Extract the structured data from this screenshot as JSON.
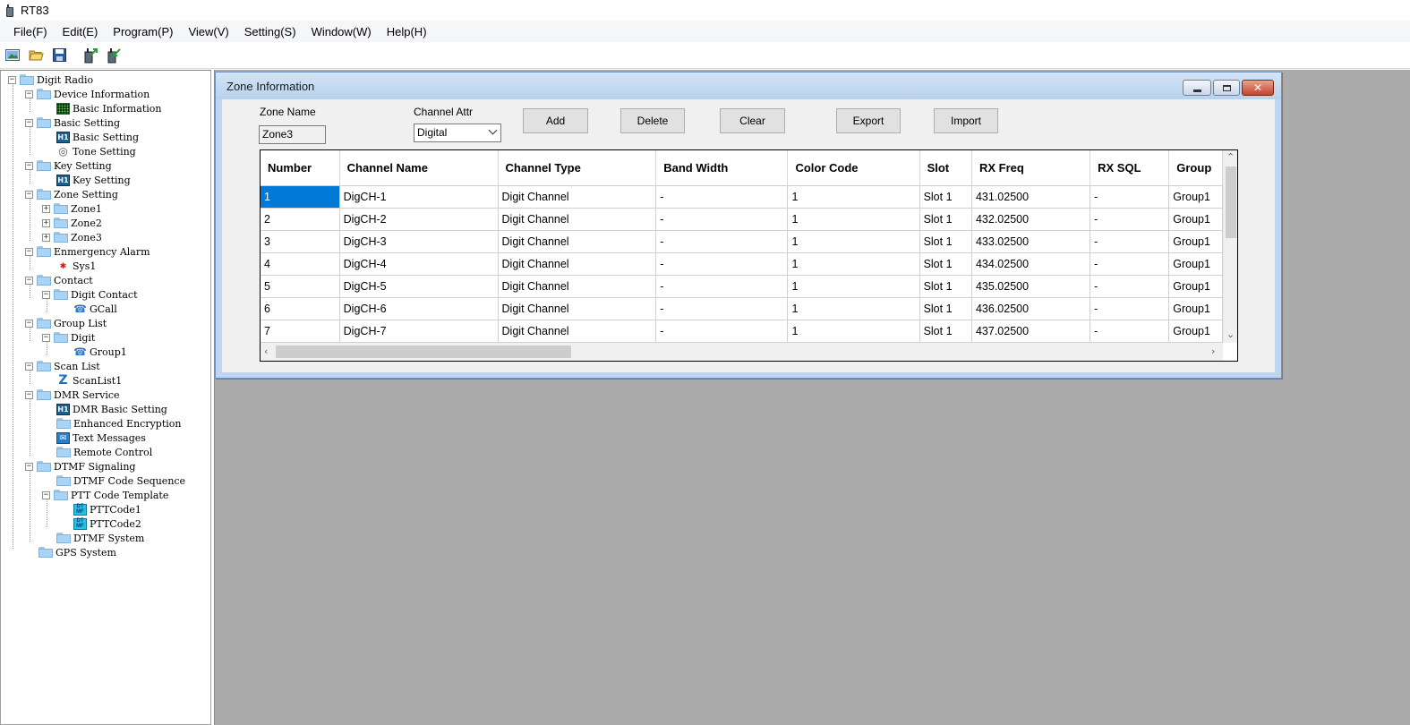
{
  "window": {
    "title": "RT83"
  },
  "menu": [
    "File(F)",
    "Edit(E)",
    "Program(P)",
    "View(V)",
    "Setting(S)",
    "Window(W)",
    "Help(H)"
  ],
  "toolbar": [
    "new-icon",
    "open-icon",
    "save-icon",
    "read-radio-icon",
    "write-radio-icon"
  ],
  "tree": {
    "root": "Digit Radio",
    "nodes": [
      {
        "label": "Device Information"
      },
      {
        "label": "Basic Information"
      },
      {
        "label": "Basic Setting"
      },
      {
        "label": "Basic Setting"
      },
      {
        "label": "Tone Setting"
      },
      {
        "label": "Key Setting"
      },
      {
        "label": "Key Setting"
      },
      {
        "label": "Zone Setting"
      },
      {
        "label": "Zone1"
      },
      {
        "label": "Zone2"
      },
      {
        "label": "Zone3"
      },
      {
        "label": "Enmergency Alarm"
      },
      {
        "label": "Sys1"
      },
      {
        "label": "Contact"
      },
      {
        "label": "Digit Contact"
      },
      {
        "label": "GCall"
      },
      {
        "label": "Group List"
      },
      {
        "label": "Digit"
      },
      {
        "label": "Group1"
      },
      {
        "label": "Scan List"
      },
      {
        "label": "ScanList1"
      },
      {
        "label": "DMR Service"
      },
      {
        "label": "DMR Basic Setting"
      },
      {
        "label": "Enhanced Encryption"
      },
      {
        "label": "Text Messages"
      },
      {
        "label": "Remote Control"
      },
      {
        "label": "DTMF Signaling"
      },
      {
        "label": "DTMF Code Sequence"
      },
      {
        "label": "PTT Code Template"
      },
      {
        "label": "PTTCode1"
      },
      {
        "label": "PTTCode2"
      },
      {
        "label": "DTMF System"
      },
      {
        "label": "GPS System"
      }
    ]
  },
  "zone_window": {
    "title": "Zone Information",
    "zone_name_label": "Zone Name",
    "zone_name_value": "Zone3",
    "channel_attr_label": "Channel Attr",
    "channel_attr_value": "Digital",
    "buttons": {
      "add": "Add",
      "delete": "Delete",
      "clear": "Clear",
      "export": "Export",
      "import": "Import"
    },
    "columns": [
      "Number",
      "Channel Name",
      "Channel Type",
      "Band Width",
      "Color Code",
      "Slot",
      "RX Freq",
      "RX SQL",
      "Group"
    ],
    "rows": [
      [
        "1",
        "DigCH-1",
        "Digit Channel",
        "-",
        "1",
        "Slot 1",
        "431.02500",
        "-",
        "Group1"
      ],
      [
        "2",
        "DigCH-2",
        "Digit Channel",
        "-",
        "1",
        "Slot 1",
        "432.02500",
        "-",
        "Group1"
      ],
      [
        "3",
        "DigCH-3",
        "Digit Channel",
        "-",
        "1",
        "Slot 1",
        "433.02500",
        "-",
        "Group1"
      ],
      [
        "4",
        "DigCH-4",
        "Digit Channel",
        "-",
        "1",
        "Slot 1",
        "434.02500",
        "-",
        "Group1"
      ],
      [
        "5",
        "DigCH-5",
        "Digit Channel",
        "-",
        "1",
        "Slot 1",
        "435.02500",
        "-",
        "Group1"
      ],
      [
        "6",
        "DigCH-6",
        "Digit Channel",
        "-",
        "1",
        "Slot 1",
        "436.02500",
        "-",
        "Group1"
      ],
      [
        "7",
        "DigCH-7",
        "Digit Channel",
        "-",
        "1",
        "Slot 1",
        "437.02500",
        "-",
        "Group1"
      ]
    ]
  },
  "colors": {
    "selection": "#0078d7",
    "mdi_background": "#ababab",
    "window_frame": "#bfd6ee"
  }
}
